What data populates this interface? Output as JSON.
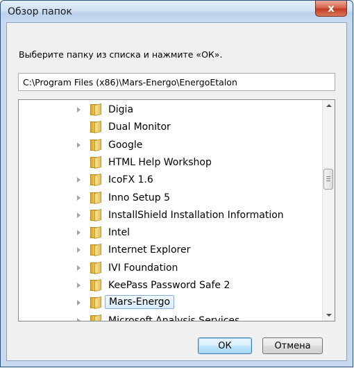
{
  "window": {
    "title": "Обзор папок",
    "close_label": "x"
  },
  "prompt": "Выберите папку из списка и нажмите «ОК».",
  "path": "C:\\Program Files (x86)\\Mars-Energo\\EnergoEtalon",
  "tree": {
    "items": [
      {
        "label": "Digia",
        "has_children": true,
        "selected": false
      },
      {
        "label": "Dual Monitor",
        "has_children": false,
        "selected": false
      },
      {
        "label": "Google",
        "has_children": true,
        "selected": false
      },
      {
        "label": "HTML Help Workshop",
        "has_children": false,
        "selected": false
      },
      {
        "label": "IcoFX 1.6",
        "has_children": true,
        "selected": false
      },
      {
        "label": "Inno Setup 5",
        "has_children": true,
        "selected": false
      },
      {
        "label": "InstallShield Installation Information",
        "has_children": true,
        "selected": false
      },
      {
        "label": "Intel",
        "has_children": true,
        "selected": false
      },
      {
        "label": "Internet Explorer",
        "has_children": true,
        "selected": false
      },
      {
        "label": "IVI Foundation",
        "has_children": true,
        "selected": false
      },
      {
        "label": "KeePass Password Safe 2",
        "has_children": true,
        "selected": false
      },
      {
        "label": "Mars-Energo",
        "has_children": true,
        "selected": true
      },
      {
        "label": "Microsoft Analysis Services",
        "has_children": true,
        "selected": false
      }
    ]
  },
  "buttons": {
    "ok": "ОК",
    "cancel": "Отмена"
  }
}
